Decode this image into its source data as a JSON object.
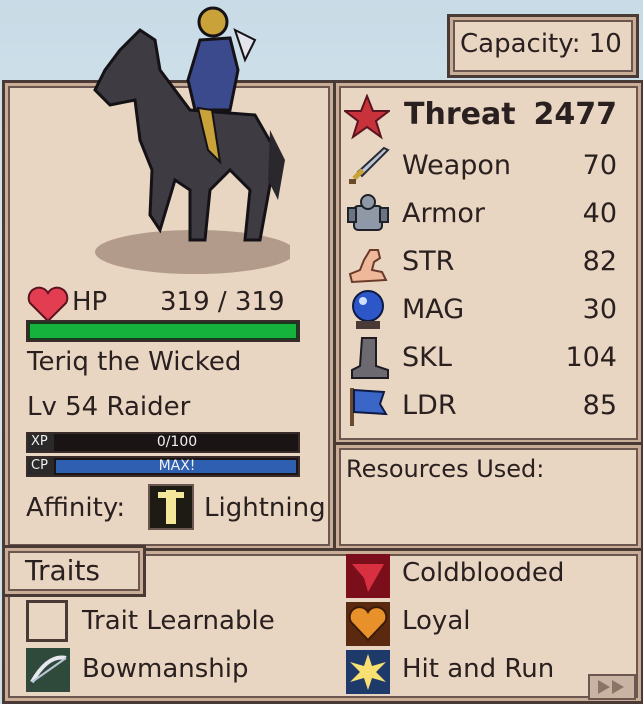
{
  "capacity": {
    "label": "Capacity: 10"
  },
  "unit": {
    "hp_label": "HP",
    "hp_value": "319 / 319",
    "hp_fraction": 1.0,
    "name": "Teriq the Wicked",
    "level_class": "Lv 54 Raider",
    "xp_tag": "XP",
    "xp_text": "0/100",
    "xp_fraction": 0.0,
    "cp_tag": "CP",
    "cp_text": "MAX!",
    "cp_fraction": 1.0,
    "affinity_label": "Affinity:",
    "affinity_value": "Lightning"
  },
  "stats": {
    "threat_label": "Threat",
    "threat_value": "2477",
    "rows": [
      {
        "label": "Weapon",
        "value": "70",
        "icon": "sword-icon"
      },
      {
        "label": "Armor",
        "value": "40",
        "icon": "armor-icon"
      },
      {
        "label": "STR",
        "value": "82",
        "icon": "arm-icon"
      },
      {
        "label": "MAG",
        "value": "30",
        "icon": "crystal-ball-icon"
      },
      {
        "label": "SKL",
        "value": "104",
        "icon": "boot-icon"
      },
      {
        "label": "LDR",
        "value": "85",
        "icon": "flag-icon"
      }
    ]
  },
  "resources": {
    "label": "Resources Used:"
  },
  "traits": {
    "title": "Traits",
    "left": [
      {
        "label": "Trait Learnable",
        "icon": "empty-slot-icon"
      },
      {
        "label": "Bowmanship",
        "icon": "bow-icon"
      }
    ],
    "right": [
      {
        "label": "Coldblooded",
        "icon": "coldblooded-icon"
      },
      {
        "label": "Loyal",
        "icon": "heart-icon"
      },
      {
        "label": "Hit and Run",
        "icon": "burst-icon"
      }
    ]
  },
  "colors": {
    "panel": "#e9d6c2",
    "border": "#4a3a35",
    "hp_bar": "#16b33c",
    "cp_bar": "#2e5fb0",
    "threat_star": "#c8323a"
  }
}
